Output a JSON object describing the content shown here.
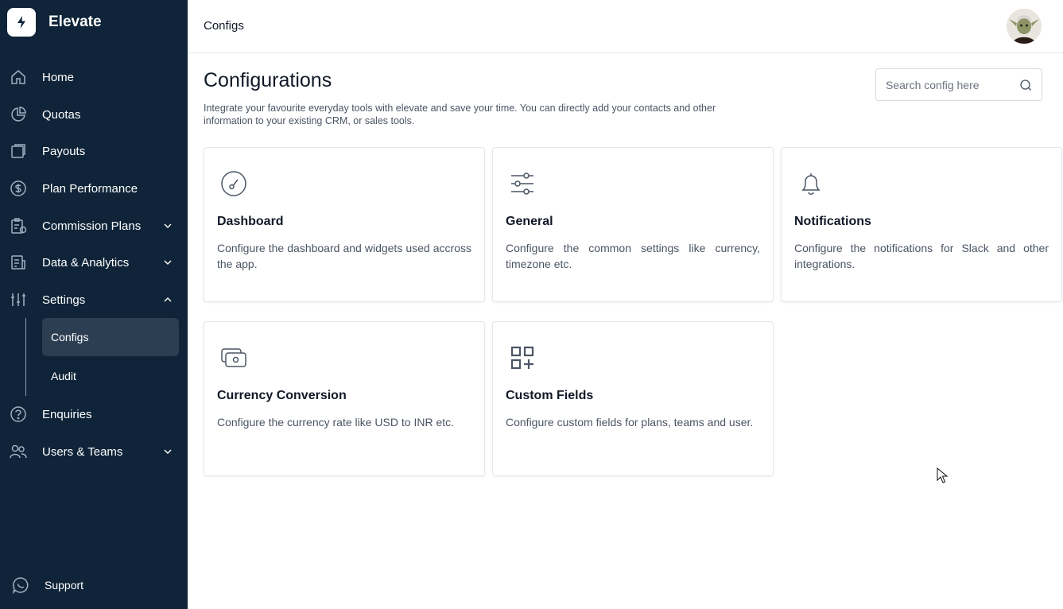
{
  "brand": {
    "name": "Elevate",
    "icon": "lightning-icon"
  },
  "sidebar": {
    "items": [
      {
        "label": "Home",
        "icon": "home-icon",
        "expandable": false
      },
      {
        "label": "Quotas",
        "icon": "pie-chart-icon",
        "expandable": false
      },
      {
        "label": "Payouts",
        "icon": "payouts-icon",
        "expandable": false
      },
      {
        "label": "Plan Performance",
        "icon": "dollar-circle-icon",
        "expandable": false
      },
      {
        "label": "Commission Plans",
        "icon": "clipboard-icon",
        "expandable": true,
        "state": "collapsed"
      },
      {
        "label": "Data & Analytics",
        "icon": "document-chart-icon",
        "expandable": true,
        "state": "collapsed"
      },
      {
        "label": "Settings",
        "icon": "sliders-icon",
        "expandable": true,
        "state": "expanded"
      },
      {
        "label": "Enquiries",
        "icon": "question-circle-icon",
        "expandable": false
      },
      {
        "label": "Users & Teams",
        "icon": "users-icon",
        "expandable": true,
        "state": "collapsed"
      }
    ],
    "settings_children": [
      {
        "label": "Configs",
        "active": true
      },
      {
        "label": "Audit",
        "active": false
      }
    ],
    "support": {
      "label": "Support",
      "icon": "chat-icon"
    }
  },
  "topbar": {
    "title": "Configs",
    "avatar": "user-avatar"
  },
  "main": {
    "title": "Configurations",
    "description": "Integrate your favourite everyday tools with elevate and save your time. You can directly add your contacts and other information to your existing CRM, or sales tools.",
    "search": {
      "placeholder": "Search config here",
      "value": ""
    },
    "cards": [
      {
        "title": "Dashboard",
        "description": "Configure the dashboard and widgets used accross the app.",
        "icon": "gauge-icon"
      },
      {
        "title": "General",
        "description": "Configure the common settings like currency, timezone etc.",
        "icon": "adjustments-icon"
      },
      {
        "title": "Notifications",
        "description": "Configure the notifications for Slack and other integrations.",
        "icon": "bell-icon"
      },
      {
        "title": "Currency Conversion",
        "description": "Configure the currency rate like USD to INR etc.",
        "icon": "cash-icon"
      },
      {
        "title": "Custom Fields",
        "description": "Configure custom fields for plans, teams and user.",
        "icon": "grid-plus-icon"
      }
    ]
  },
  "colors": {
    "sidebar_bg": "#0f2438",
    "active_item_bg": "#2c3e52",
    "icon_stroke": "#4b5563",
    "text_primary": "#111827",
    "text_secondary": "#4b5563"
  }
}
